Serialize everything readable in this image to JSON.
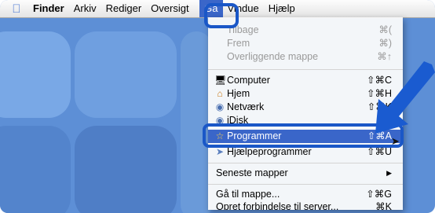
{
  "menubar": {
    "apple_icon": "apple-icon",
    "items": [
      {
        "label": "Finder"
      },
      {
        "label": "Arkiv"
      },
      {
        "label": "Rediger"
      },
      {
        "label": "Oversigt"
      },
      {
        "label": "Gå"
      },
      {
        "label": "Vindue"
      },
      {
        "label": "Hjælp"
      }
    ]
  },
  "go_menu": {
    "items": [
      {
        "label": "Tilbage",
        "shortcut": "⌘(",
        "enabled": false
      },
      {
        "label": "Frem",
        "shortcut": "⌘)",
        "enabled": false
      },
      {
        "label": "Overliggende mappe",
        "shortcut": "⌘↑",
        "enabled": false
      },
      {
        "label": "Computer",
        "shortcut": "⇧⌘C",
        "icon": "computer-icon"
      },
      {
        "label": "Hjem",
        "shortcut": "⇧⌘H",
        "icon": "home-icon"
      },
      {
        "label": "Netværk",
        "shortcut": "⇧⌘K",
        "icon": "network-icon"
      },
      {
        "label": "iDisk",
        "shortcut": "▶",
        "icon": "idisk-icon"
      },
      {
        "label": "Programmer",
        "shortcut": "⇧⌘A",
        "icon": "applications-icon",
        "selected": true
      },
      {
        "label": "Hjælpeprogrammer",
        "shortcut": "⇧⌘U",
        "icon": "utilities-icon"
      },
      {
        "label": "Seneste mapper",
        "shortcut": "▶"
      },
      {
        "label": "Gå til mappe...",
        "shortcut": "⇧⌘G"
      },
      {
        "label": "Opret forbindelse til server...",
        "shortcut": "⌘K"
      }
    ]
  },
  "colors": {
    "highlight_outline": "#1a57c7",
    "selection": "#3a66c9",
    "desktop": "#5d8fd6",
    "arrow": "#1a5bd0"
  }
}
